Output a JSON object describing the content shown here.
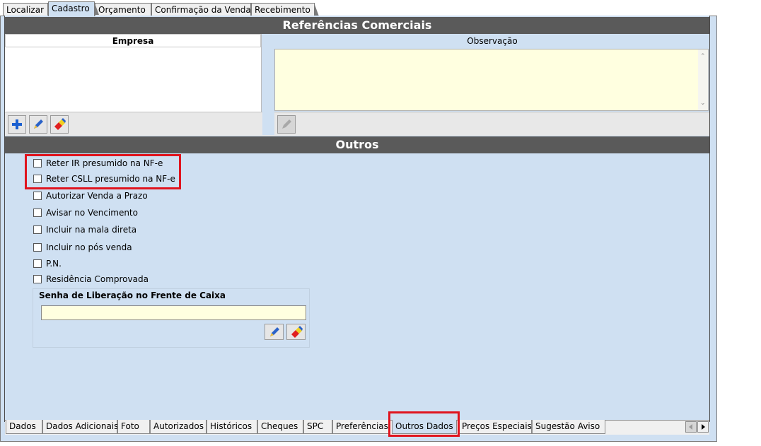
{
  "top_tabs": [
    "Localizar",
    "Cadastro",
    "Orçamento",
    "Confirmação da Venda",
    "Recebimento"
  ],
  "section_refs": {
    "title": "Referências Comerciais",
    "col_empresa": "Empresa",
    "col_observacao": "Observação"
  },
  "toolbar_icons": [
    "add-icon",
    "edit-pen-icon",
    "eraser-icon",
    "edit-pen-disabled-icon"
  ],
  "section_outros": {
    "title": "Outros",
    "checkboxes": [
      "Reter IR presumido na NF-e",
      "Reter CSLL presumido na NF-e",
      "Autorizar Venda a Prazo",
      "Avisar no Vencimento",
      "Incluir na mala direta",
      "Incluir no pós venda",
      "P.N.",
      "Residência Comprovada"
    ],
    "senha_label": "Senha de Liberação no Frente de Caixa",
    "senha_value": ""
  },
  "bottom_tabs": [
    "Dados",
    "Dados Adicionais",
    "Foto",
    "Autorizados",
    "Históricos",
    "Cheques",
    "SPC",
    "Preferências",
    "Outros Dados",
    "Preços Especiais",
    "Sugestão Aviso"
  ],
  "colors": {
    "highlight": "#e0141e",
    "panel": "#cfe0f2",
    "header": "#5a5a5a",
    "input_yellow": "#ffffe0"
  }
}
